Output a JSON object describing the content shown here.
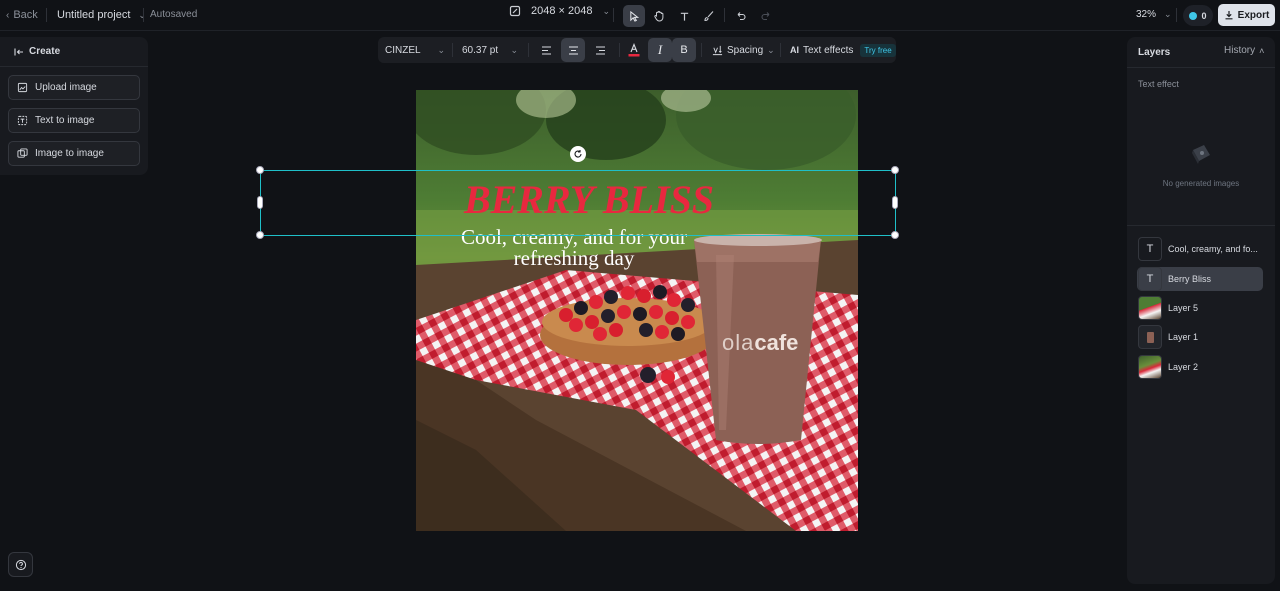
{
  "topbar": {
    "back_label": "Back",
    "project_title": "Untitled project",
    "save_status": "Autosaved",
    "canvas_size": "2048 × 2048",
    "zoom": "32%",
    "credits": "0",
    "export_label": "Export"
  },
  "create_panel": {
    "title": "Create",
    "buttons": [
      "Upload image",
      "Text to image",
      "Image to image"
    ]
  },
  "text_toolbar": {
    "font": "CINZEL",
    "font_size": "60.37 pt",
    "spacing_label": "Spacing",
    "text_effects_label": "Text effects",
    "try_free_badge": "Try free",
    "text_color": "#e8283f"
  },
  "canvas": {
    "headline": "BERRY BLISS",
    "subline_1": "Cool, creamy, and for your",
    "subline_2": "refreshing day",
    "cup_brand_light": "ola",
    "cup_brand_bold": "cafe",
    "headline_color": "#e8283f"
  },
  "layers_panel": {
    "title": "Layers",
    "history_label": "History",
    "section_label": "Text effect",
    "empty_state": "No generated images",
    "layers": [
      {
        "name": "Cool, creamy, and fo...",
        "kind": "text"
      },
      {
        "name": "Berry Bliss",
        "kind": "text"
      },
      {
        "name": "Layer 5",
        "kind": "image"
      },
      {
        "name": "Layer 1",
        "kind": "image"
      },
      {
        "name": "Layer 2",
        "kind": "image"
      }
    ]
  },
  "colors": {
    "accent_selection": "#1fbfc8",
    "export_button": "#dfe3ea",
    "try_free": "#3fc7e8"
  }
}
